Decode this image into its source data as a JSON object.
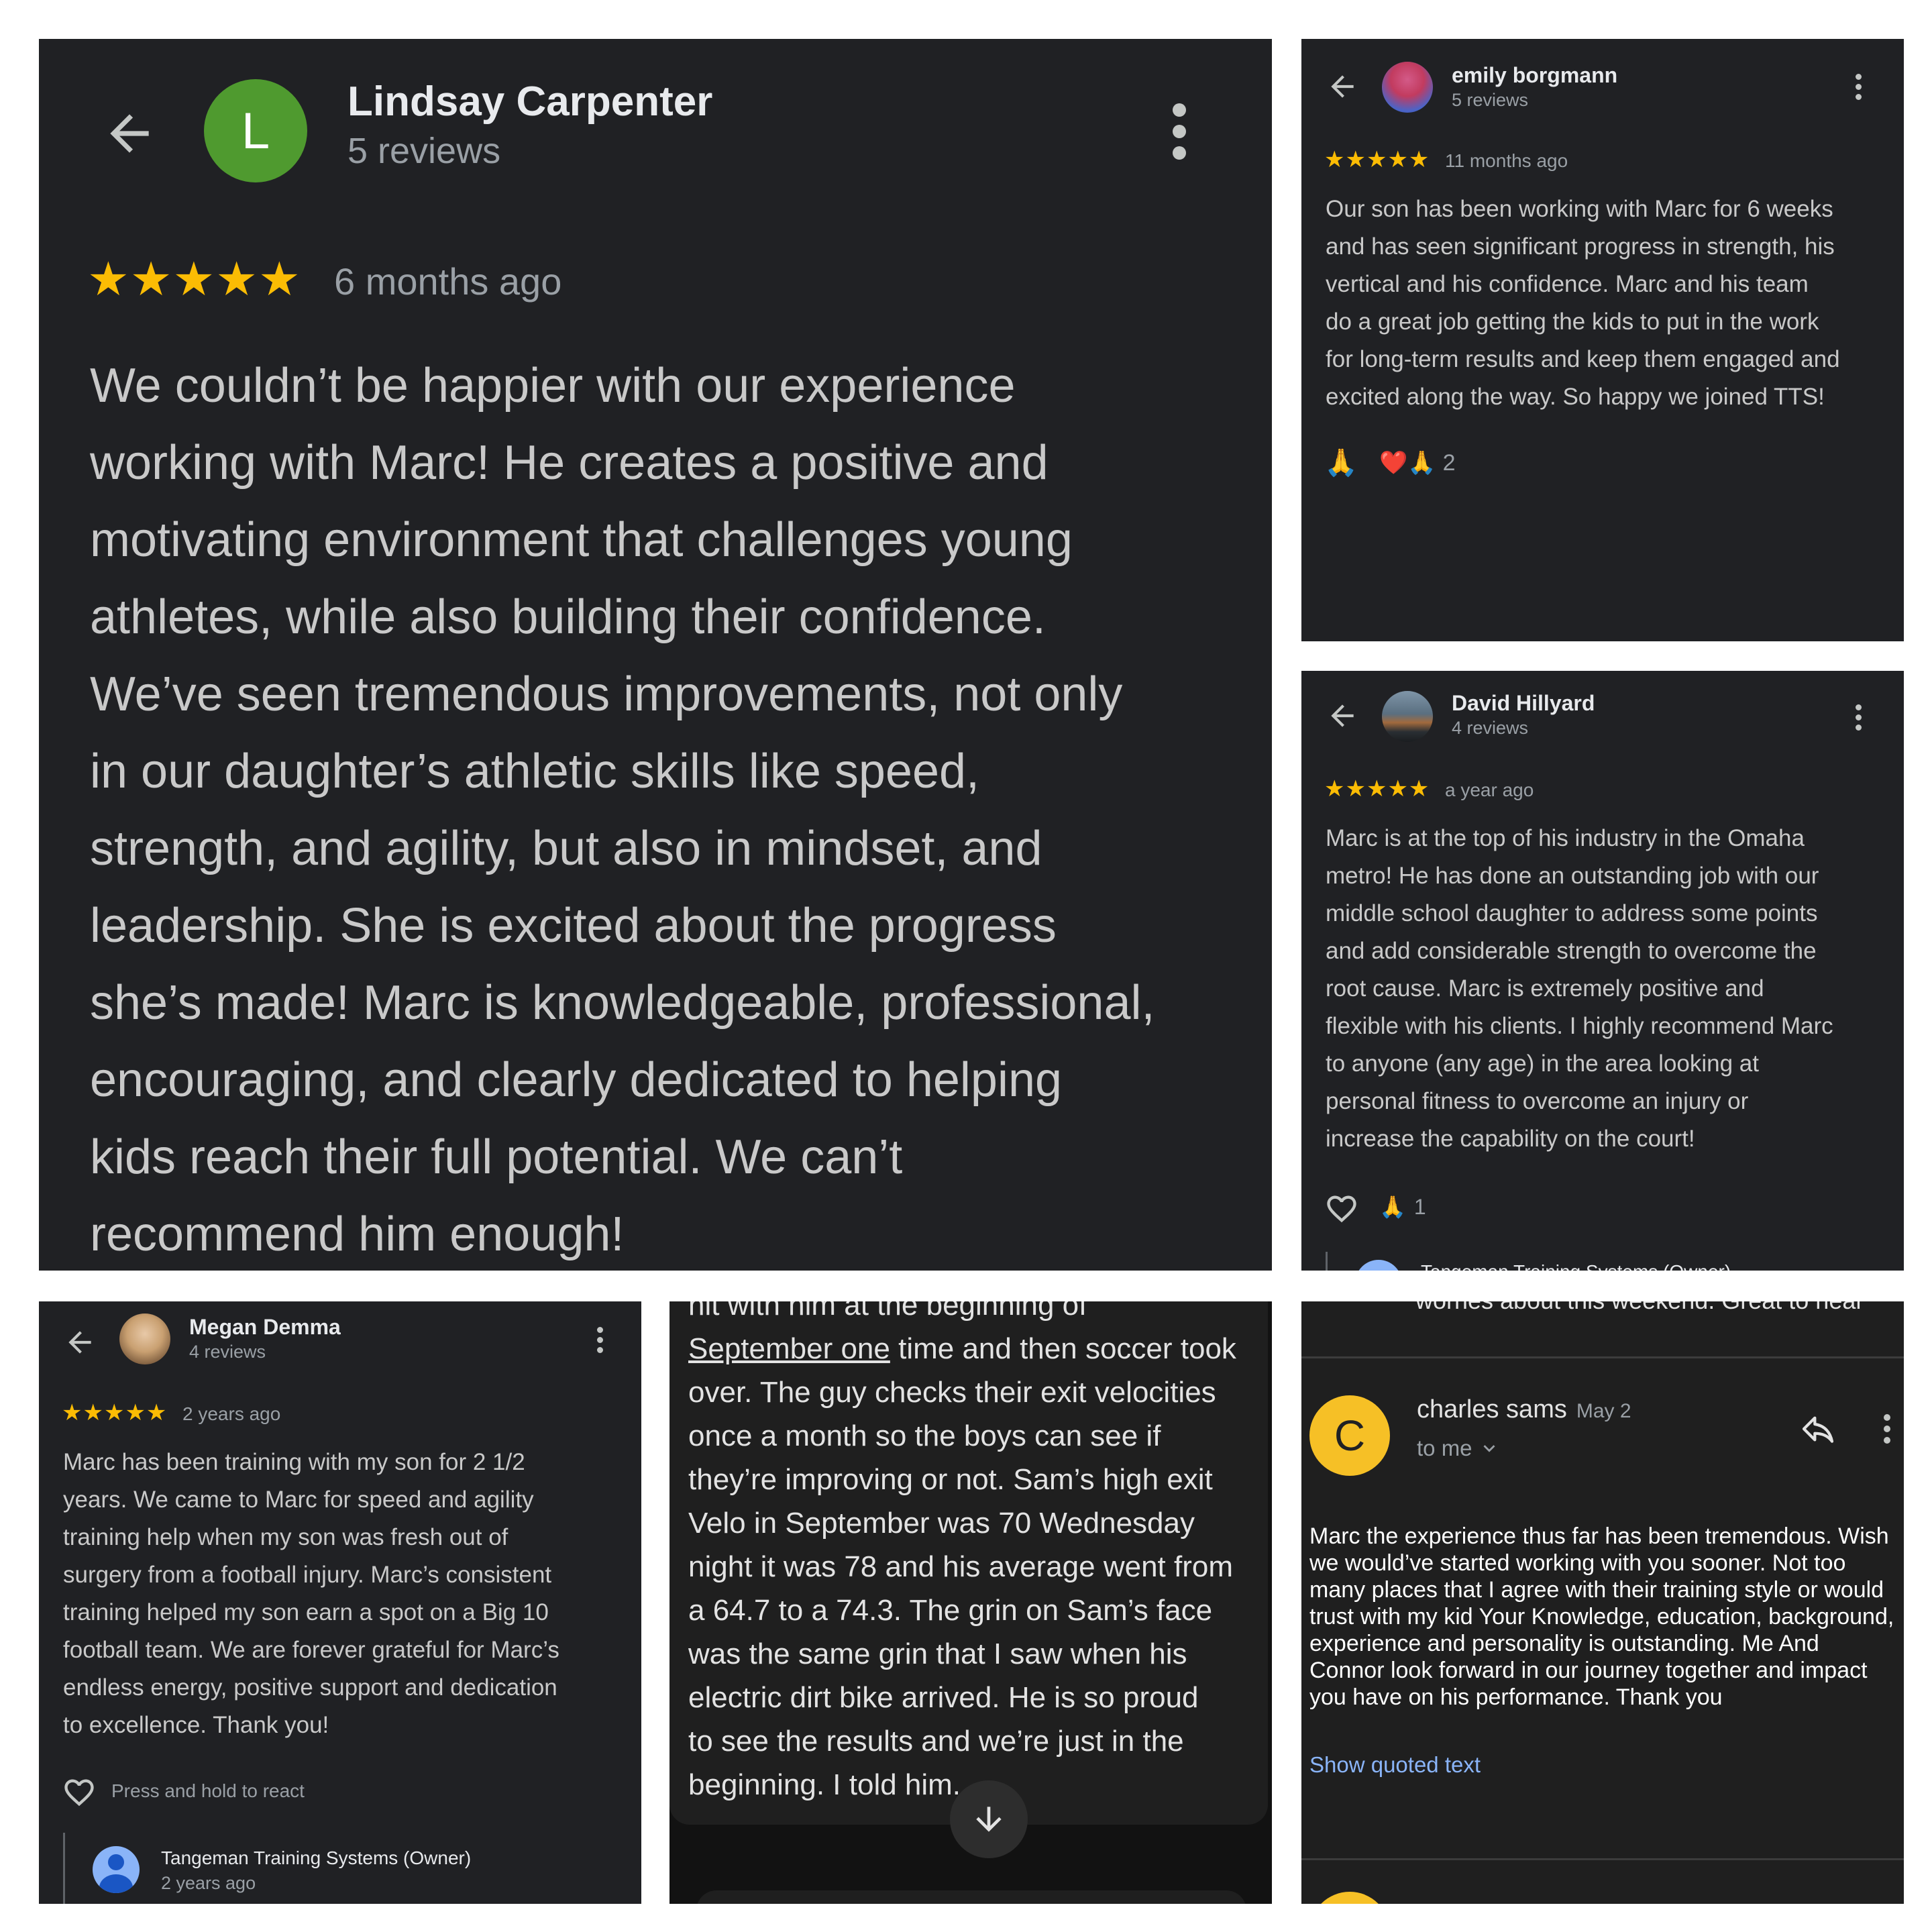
{
  "p1": {
    "name": "Lindsay Carpenter",
    "reviews": "5 reviews",
    "avatar_letter": "L",
    "avatar_color": "#4f9a2f",
    "stars": "★★★★★",
    "time": "6 months ago",
    "lines": [
      "We couldn’t be happier with our experience",
      "working with Marc! He creates a positive and",
      "motivating environment that challenges young",
      "athletes, while also building their confidence.",
      "We’ve seen tremendous improvements, not only",
      "in our daughter’s athletic skills like speed,",
      "strength, and agility, but also in mindset, and",
      "leadership. She is excited about the progress",
      "she’s made! Marc is knowledgeable, professional,",
      "encouraging, and clearly dedicated to helping",
      "kids reach their full potential. We can’t",
      "recommend him enough!"
    ]
  },
  "p2": {
    "name": "emily borgmann",
    "reviews": "5 reviews",
    "stars": "★★★★★",
    "time": "11 months ago",
    "lines": [
      "Our son has been working with Marc for 6 weeks",
      "and has seen significant progress in strength, his",
      "vertical and his confidence. Marc and his team",
      "do a great job getting the kids to put in the work",
      "for long-term results and keep them engaged and",
      "excited along the way. So happy we joined TTS!"
    ],
    "reaction_1": "🙏",
    "reaction_2": "❤️🙏",
    "reaction_count": "2"
  },
  "p3": {
    "name": "David Hillyard",
    "reviews": "4 reviews",
    "stars": "★★★★★",
    "time": "a year ago",
    "lines": [
      "Marc is at the top of his industry in the Omaha",
      "metro! He has done an outstanding job with our",
      "middle school daughter to address some points",
      "and add considerable strength to overcome the",
      "root cause. Marc is extremely positive and",
      "flexible with his clients. I highly recommend Marc",
      "to anyone (any age) in the area looking at",
      "personal fitness to overcome an injury or",
      "increase the capability on the court!"
    ],
    "reaction": "🙏",
    "reaction_count": "1",
    "owner_partial": "Tangeman Training Systems (Owner)"
  },
  "p4": {
    "name": "Megan Demma",
    "reviews": "4 reviews",
    "stars": "★★★★★",
    "time": "2 years ago",
    "lines": [
      "Marc has been training with my son for 2 1/2",
      "years. We came to Marc for speed and agility",
      "training help when my son was fresh out of",
      "surgery from a football injury. Marc’s consistent",
      "training helped my son earn a spot on a Big 10",
      "football team. We are forever grateful for Marc’s",
      "endless energy, positive support and dedication",
      "to excellence. Thank you!"
    ],
    "react_hint": "Press and hold to react",
    "owner_name": "Tangeman Training Systems (Owner)",
    "owner_time": "2 years ago"
  },
  "p5": {
    "top_partial": "hit with him at the beginning of",
    "link_text": "September one",
    "line1_rest": " time and then soccer took",
    "lines": [
      "over.  The guy checks their exit velocities",
      "once a month so the boys can see if",
      "they’re improving or not. Sam’s high exit",
      "Velo in September was 70 Wednesday",
      "night it was 78 and his average went from",
      "a 64.7 to a 74.3.  The grin on Sam’s face",
      "was the same grin that I saw when his",
      "electric dirt bike arrived.   He is so proud",
      "to see the results and we’re just in the",
      "beginning. I told him."
    ]
  },
  "p6": {
    "top_partial": "worries about this weekend. Great to hear",
    "avatar_letter": "C",
    "avatar_color": "#f6c026",
    "name": "charles sams",
    "date": "May 2",
    "to_me": "to me",
    "lines": [
      "Marc the experience thus far has been tremendous. Wish",
      "we would’ve started working with you sooner. Not too",
      "many places that I agree with their training style or would",
      "trust with my kid Your Knowledge, education, background,",
      "experience and personality is outstanding. Me And",
      "Connor look forward in our journey together and impact",
      "you have on his performance. Thank you"
    ],
    "show_quoted": "Show quoted text"
  }
}
